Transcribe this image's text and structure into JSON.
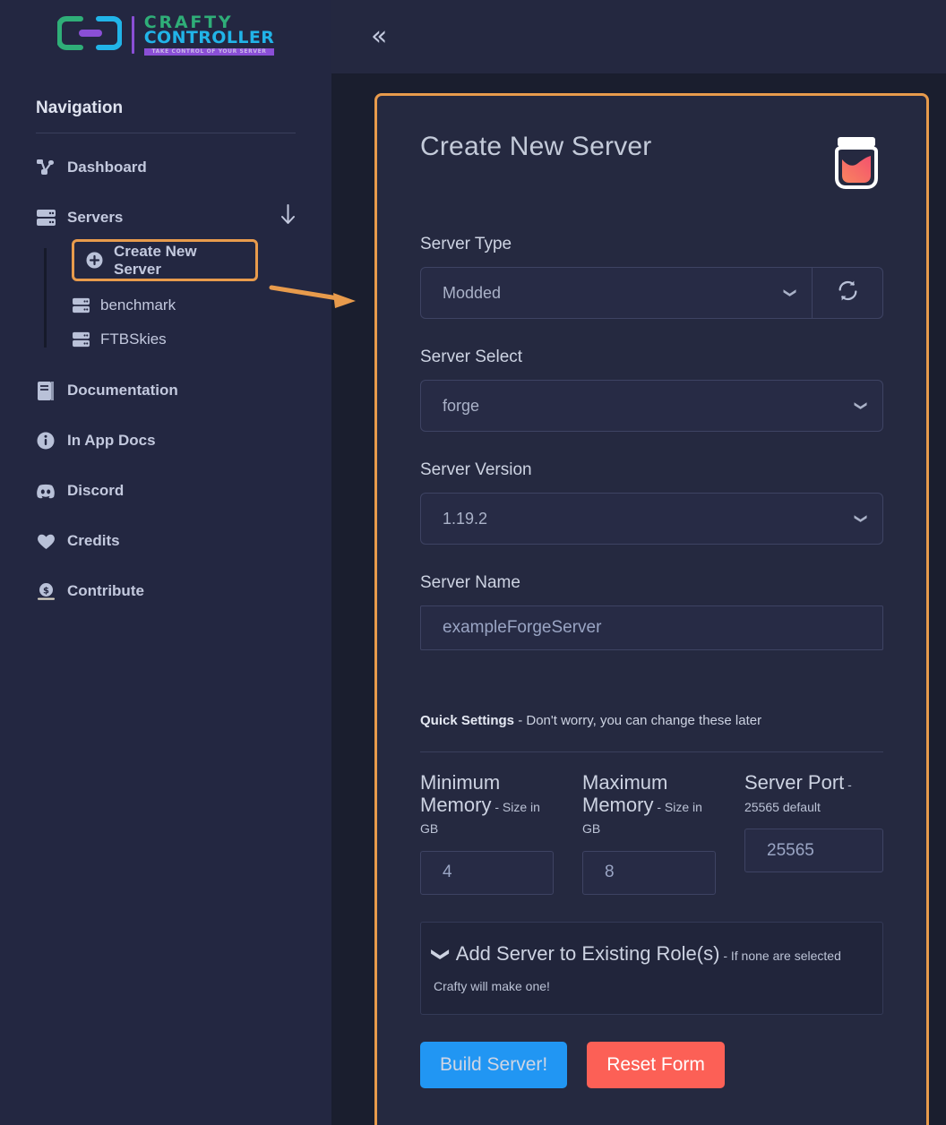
{
  "brand": {
    "name_primary": "CRAFTY",
    "name_secondary": "CONTROLLER",
    "tagline": "TAKE CONTROL OF YOUR SERVER",
    "color_primary": "#2fae78",
    "color_secondary": "#21b4e8",
    "color_accent": "#8a4fd6"
  },
  "sidebar": {
    "title": "Navigation",
    "items": [
      {
        "label": "Dashboard",
        "icon": "sitemap-icon"
      },
      {
        "label": "Servers",
        "icon": "server-icon",
        "trailing_icon": "arrow-down-icon"
      },
      {
        "label": "Documentation",
        "icon": "book-icon"
      },
      {
        "label": "In App Docs",
        "icon": "info-circle-icon"
      },
      {
        "label": "Discord",
        "icon": "discord-icon"
      },
      {
        "label": "Credits",
        "icon": "heart-icon"
      },
      {
        "label": "Contribute",
        "icon": "donate-icon"
      }
    ],
    "server_children": [
      {
        "label": "Create New Server",
        "icon": "plus-circle-icon",
        "highlighted": true
      },
      {
        "label": "benchmark",
        "icon": "server-icon",
        "highlighted": false
      },
      {
        "label": "FTBSkies",
        "icon": "server-icon",
        "highlighted": false
      }
    ]
  },
  "topbar": {
    "collapse_icon": "«"
  },
  "main": {
    "title": "Create New Server",
    "header_icon": "jar-icon",
    "highlight_color": "#e89b4c",
    "fields": {
      "server_type": {
        "label": "Server Type",
        "value": "Modded",
        "refresh_icon": "refresh-icon"
      },
      "server_select": {
        "label": "Server Select",
        "value": "forge"
      },
      "server_version": {
        "label": "Server Version",
        "value": "1.19.2"
      },
      "server_name": {
        "label": "Server Name",
        "value": "exampleForgeServer"
      }
    },
    "quick_settings": {
      "heading": "Quick Settings",
      "heading_note": " - Don't worry, you can change these later",
      "min_memory": {
        "label": "Minimum Memory",
        "note": " - Size in GB",
        "value": "4"
      },
      "max_memory": {
        "label": "Maximum Memory",
        "note": " - Size in GB",
        "value": "8"
      },
      "server_port": {
        "label": "Server Port",
        "note": " - 25565 default",
        "value": "25565"
      }
    },
    "roles": {
      "title": "Add Server to Existing Role(s)",
      "note": " - If none are selected Crafty will make one!",
      "caret_icon": "chevron-down-icon"
    },
    "buttons": {
      "build": {
        "label": "Build Server!",
        "color": "#2196f3"
      },
      "reset": {
        "label": "Reset Form",
        "color": "#fc6056"
      }
    }
  }
}
